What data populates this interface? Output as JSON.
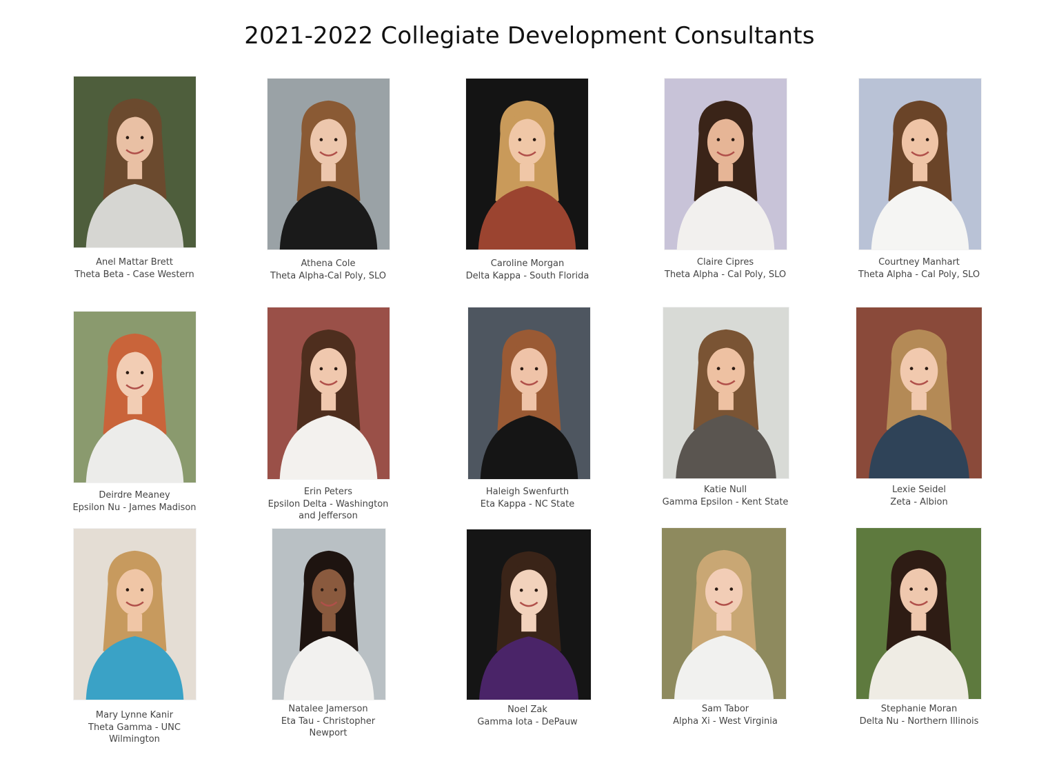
{
  "title": "2021-2022 Collegiate Development Consultants",
  "consultants": [
    {
      "name": "Anel Mattar Brett",
      "chapter": "Theta Beta - Case Western",
      "bg": "#4e5e3c",
      "hair": "#6b4a2e",
      "skin": "#e9c0a4",
      "top": "#d6d6d2"
    },
    {
      "name": "Athena Cole",
      "chapter": "Theta Alpha-Cal Poly, SLO",
      "bg": "#9aa2a6",
      "hair": "#8a5a34",
      "skin": "#edc7ad",
      "top": "#1a1a1a"
    },
    {
      "name": "Caroline Morgan",
      "chapter": "Delta Kappa - South Florida",
      "bg": "#141414",
      "hair": "#c99a5a",
      "skin": "#f0c7a7",
      "top": "#9b4430"
    },
    {
      "name": "Claire Cipres",
      "chapter": "Theta Alpha - Cal Poly, SLO",
      "bg": "#c8c3d8",
      "hair": "#3a2418",
      "skin": "#e6b596",
      "top": "#f2f0ee"
    },
    {
      "name": "Courtney Manhart",
      "chapter": "Theta Alpha - Cal Poly, SLO",
      "bg": "#b9c2d6",
      "hair": "#6a4428",
      "skin": "#efc4a6",
      "top": "#f5f5f3"
    },
    {
      "name": "Deirdre Meaney",
      "chapter": "Epsilon Nu - James Madison",
      "bg": "#8a9a6e",
      "hair": "#c9643a",
      "skin": "#f2cdb4",
      "top": "#ececea"
    },
    {
      "name": "Erin Peters",
      "chapter": "Epsilon Delta - Washington\nand Jefferson",
      "bg": "#9a5048",
      "hair": "#4e2e1e",
      "skin": "#f0c8ae",
      "top": "#f3f1ee"
    },
    {
      "name": "Haleigh Swenfurth",
      "chapter": "Eta Kappa - NC State",
      "bg": "#4e5660",
      "hair": "#9a5a34",
      "skin": "#efc3a8",
      "top": "#151515"
    },
    {
      "name": "Katie Null",
      "chapter": "Gamma Epsilon - Kent State",
      "bg": "#d8dad6",
      "hair": "#7a5434",
      "skin": "#eec1a2",
      "top": "#5a5550"
    },
    {
      "name": "Lexie Seidel",
      "chapter": "Zeta - Albion",
      "bg": "#8a4a3a",
      "hair": "#b48a56",
      "skin": "#f1c9ae",
      "top": "#2f4358"
    },
    {
      "name": "Mary Lynne Kanir",
      "chapter": "Theta Gamma - UNC\nWilmington",
      "bg": "#e4ddd4",
      "hair": "#c79a5e",
      "skin": "#f0c6a6",
      "top": "#3aa2c6"
    },
    {
      "name": "Natalee Jamerson",
      "chapter": "Eta Tau - Christopher\nNewport",
      "bg": "#b9c0c4",
      "hair": "#1e1410",
      "skin": "#8a5a3e",
      "top": "#f2f1ef"
    },
    {
      "name": "Noel Zak",
      "chapter": "Gamma Iota - DePauw",
      "bg": "#151515",
      "hair": "#3a2418",
      "skin": "#f2d2bc",
      "top": "#4a2468"
    },
    {
      "name": "Sam Tabor",
      "chapter": "Alpha Xi - West Virginia",
      "bg": "#8e8a5e",
      "hair": "#c9a774",
      "skin": "#f2cdb6",
      "top": "#f1f1ef"
    },
    {
      "name": "Stephanie Moran",
      "chapter": "Delta Nu - Northern Illinois",
      "bg": "#5e7a3e",
      "hair": "#2e1c14",
      "skin": "#efc8ae",
      "top": "#efece4"
    }
  ]
}
